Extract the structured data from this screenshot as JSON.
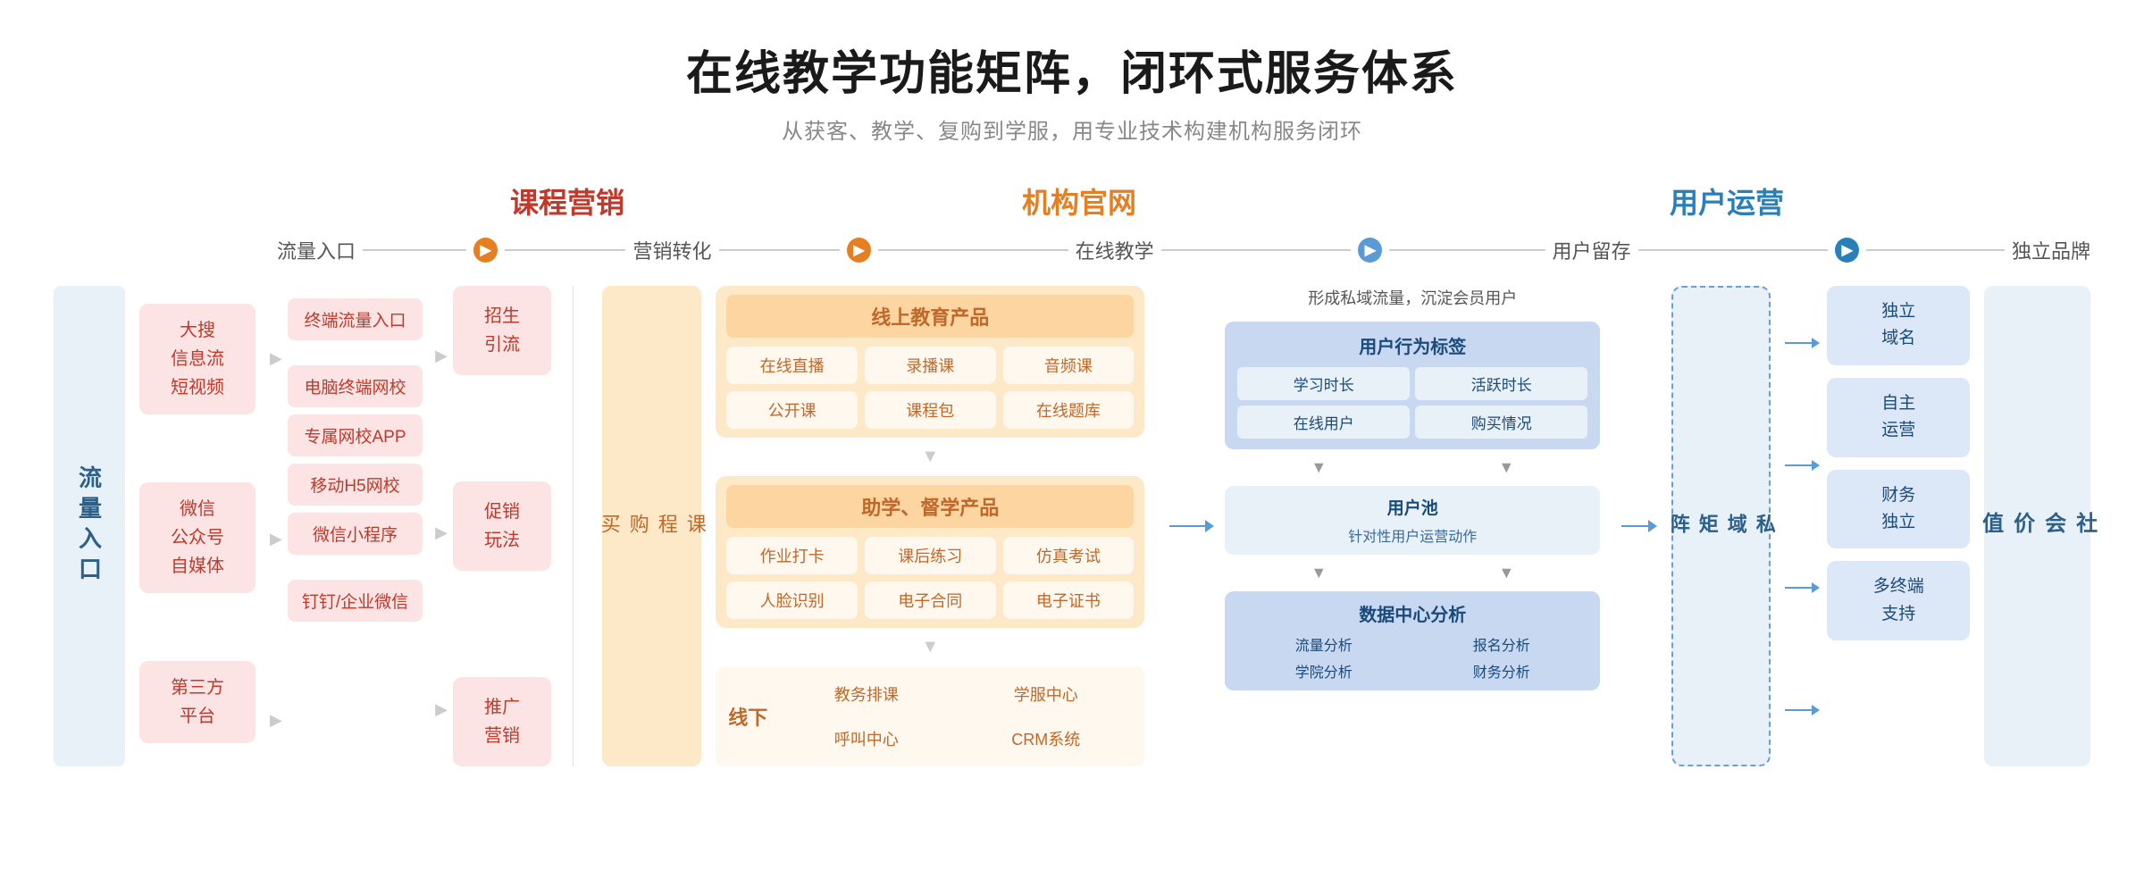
{
  "header": {
    "title": "在线教学功能矩阵，闭环式服务体系",
    "subtitle": "从获客、教学、复购到学服，用专业技术构建机构服务闭环"
  },
  "categories": {
    "marketing": "课程营销",
    "website": "机构官网",
    "operations": "用户运营"
  },
  "flowSteps": {
    "step1": "流量入口",
    "step2": "营销转化",
    "step3": "在线教学",
    "step4": "用户留存",
    "step5": "独立品牌"
  },
  "leftLabel": "流量入口",
  "trafficSources": [
    {
      "text": "大搜\n信息流\n短视频"
    },
    {
      "text": "微信\n公众号\n自媒体"
    },
    {
      "text": "第三方\n平台"
    }
  ],
  "terminalFlows": [
    {
      "text": "终端流量入口"
    },
    {
      "text": "电脑终端网校"
    },
    {
      "text": "专属网校APP"
    },
    {
      "text": "移动H5网校"
    },
    {
      "text": "微信小程序"
    },
    {
      "text": "钉钉/企业微信"
    }
  ],
  "conversionBoxes": [
    {
      "text": "招生\n引流"
    },
    {
      "text": "促销\n玩法"
    },
    {
      "text": "推广\n营销"
    }
  ],
  "coursePurchase": "课程购买",
  "onlineTeaching": {
    "title": "线上教育产品",
    "items": [
      "在线直播",
      "录播课",
      "音频课",
      "公开课",
      "课程包",
      "在线题库"
    ],
    "assistTitle": "助学、督学产品",
    "assistItems": [
      "作业打卡",
      "课后练习",
      "仿真考试",
      "人脸识别",
      "电子合同",
      "电子证书"
    ],
    "offlineLabel": "线下",
    "offlineItems": [
      "教务排课",
      "学服中心",
      "呼叫中心",
      "CRM系统"
    ]
  },
  "userRetention": {
    "headerText": "形成私域流量，沉淀会员用户",
    "behaviorTitle": "用户行为标签",
    "behaviorTags": [
      "学习时长",
      "活跃时长",
      "在线用户",
      "购买情况"
    ],
    "userPoolTitle": "用户池",
    "userPoolSub": "针对性用户运营动作",
    "dataCenterTitle": "数据中心分析",
    "dataCenterItems": [
      "流量分析",
      "报名分析",
      "学院分析",
      "财务分析"
    ]
  },
  "privateMatrix": "私域矩阵",
  "brandItems": [
    "独立\n域名",
    "自主\n运营",
    "财务\n独立",
    "多终端\n支持"
  ],
  "socialValue": "社会价值"
}
